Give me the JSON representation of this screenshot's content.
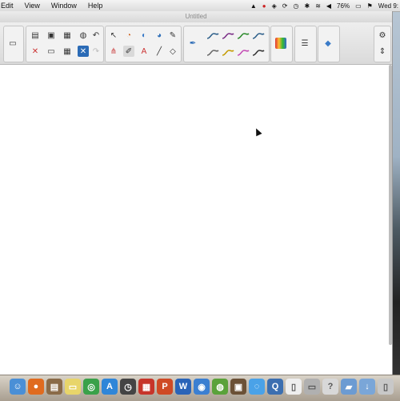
{
  "menubar": {
    "items": [
      "Edit",
      "View",
      "Window",
      "Help"
    ],
    "battery": "76%",
    "clock": "Wed 9:"
  },
  "window": {
    "title": "Untitled"
  },
  "toolbar": {
    "pen_colors": [
      "#2d5f8a",
      "#7a2d86",
      "#2b8a2b",
      "#2d5f8a",
      "#666666",
      "#c49b00",
      "#c44bb4",
      "#333333"
    ]
  },
  "dock": {
    "icons": [
      {
        "name": "finder-icon",
        "color": "#4a8fd6",
        "glyph": "☺"
      },
      {
        "name": "firefox-icon",
        "color": "#e06b1f",
        "glyph": "●"
      },
      {
        "name": "contacts-icon",
        "color": "#8a6b48",
        "glyph": "▤"
      },
      {
        "name": "notes-icon",
        "color": "#e8d56a",
        "glyph": "▭"
      },
      {
        "name": "chrome-icon",
        "color": "#3aa14a",
        "glyph": "◎"
      },
      {
        "name": "app-store-icon",
        "color": "#2f86d8",
        "glyph": "A"
      },
      {
        "name": "dashboard-icon",
        "color": "#444444",
        "glyph": "◷"
      },
      {
        "name": "calendar-icon",
        "color": "#c7352a",
        "glyph": "▦"
      },
      {
        "name": "powerpoint-icon",
        "color": "#cf4a25",
        "glyph": "P"
      },
      {
        "name": "word-icon",
        "color": "#2a64b8",
        "glyph": "W"
      },
      {
        "name": "globe-icon",
        "color": "#3b7fd1",
        "glyph": "◉"
      },
      {
        "name": "network-icon",
        "color": "#5aa23a",
        "glyph": "◍"
      },
      {
        "name": "photo-icon",
        "color": "#6b5136",
        "glyph": "▣"
      },
      {
        "name": "messages-icon",
        "color": "#4aa2e8",
        "glyph": "◌"
      },
      {
        "name": "preview-icon",
        "color": "#3c6fb0",
        "glyph": "Q"
      },
      {
        "name": "document-icon",
        "color": "#eeeeee",
        "glyph": "▯"
      },
      {
        "name": "printer-icon",
        "color": "#b0b0b0",
        "glyph": "▭"
      },
      {
        "name": "help-icon",
        "color": "#d8d8d8",
        "glyph": "?"
      },
      {
        "name": "folder-icon",
        "color": "#6c9bd2",
        "glyph": "▰"
      },
      {
        "name": "download-icon",
        "color": "#7aa6d8",
        "glyph": "↓"
      },
      {
        "name": "trash-icon",
        "color": "#c8c8c8",
        "glyph": "▯"
      }
    ]
  }
}
